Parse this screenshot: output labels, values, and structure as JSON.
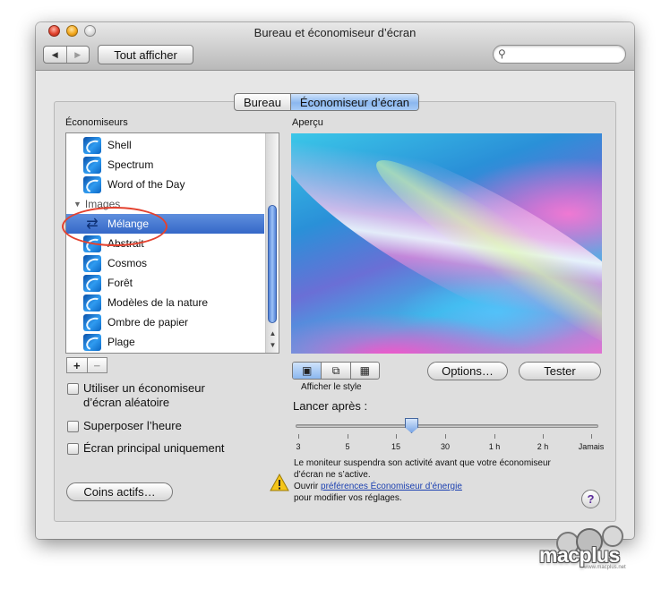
{
  "window": {
    "title": "Bureau et économiseur d’écran"
  },
  "toolbar": {
    "show_all_label": "Tout afficher",
    "back_glyph": "◀",
    "forward_glyph": "▶",
    "search_placeholder": ""
  },
  "tabs": [
    {
      "label": "Bureau",
      "active": false
    },
    {
      "label": "Économiseur d’écran",
      "active": true
    }
  ],
  "savers": {
    "heading": "Économiseurs",
    "items": [
      {
        "label": "Shell",
        "type": "item"
      },
      {
        "label": "Spectrum",
        "type": "item"
      },
      {
        "label": "Word of the Day",
        "type": "item"
      },
      {
        "label": "Images",
        "type": "group"
      },
      {
        "label": "Mélange",
        "type": "selected"
      },
      {
        "label": "Abstrait",
        "type": "item"
      },
      {
        "label": "Cosmos",
        "type": "item"
      },
      {
        "label": "Forêt",
        "type": "item"
      },
      {
        "label": "Modèles de la nature",
        "type": "item"
      },
      {
        "label": "Ombre de papier",
        "type": "item"
      },
      {
        "label": "Plage",
        "type": "item"
      }
    ],
    "add_label": "+",
    "remove_label": "−"
  },
  "options": {
    "random_label": "Utiliser un économiseur d’écran aléatoire",
    "random_line1": "Utiliser un économiseur",
    "random_line2": "d’écran aléatoire",
    "clock_label": "Superposer l’heure",
    "main_screen_label": "Écran principal uniquement",
    "hot_corners_label": "Coins actifs…"
  },
  "preview": {
    "heading": "Aperçu",
    "display_style_label": "Afficher le style",
    "options_button": "Options…",
    "test_button": "Tester"
  },
  "start_after": {
    "label": "Lancer après :",
    "ticks": [
      "3",
      "5",
      "15",
      "30",
      "1 h",
      "2 h",
      "Jamais"
    ],
    "value_fraction": 0.39
  },
  "notice": {
    "line1": "Le moniteur suspendra son activité avant que votre économiseur",
    "line2": "d’écran ne s’active.",
    "open_prefix": "Ouvrir",
    "link": "préférences Économiseur d’énergie",
    "line4": "pour modifier vos réglages."
  },
  "help_label": "?",
  "watermark": {
    "text": "macplus",
    "url": "www.macplus.net"
  },
  "colors": {
    "selection": "#3568c8",
    "accent": "#8bb7ef",
    "annotation": "#e4422f"
  }
}
